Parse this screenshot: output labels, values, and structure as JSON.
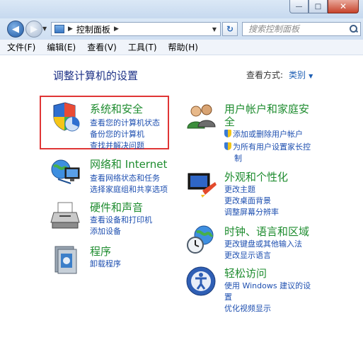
{
  "window": {
    "controls": {
      "minimize": "—",
      "maximize": "□",
      "close": "✕"
    }
  },
  "nav": {
    "back_icon": "arrow-left-icon",
    "forward_icon": "arrow-right-icon",
    "breadcrumb": [
      "控制面板"
    ],
    "refresh_symbol": "↻",
    "search_placeholder": "搜索控制面板"
  },
  "menu": [
    "文件(F)",
    "编辑(E)",
    "查看(V)",
    "工具(T)",
    "帮助(H)"
  ],
  "content": {
    "heading": "调整计算机的设置",
    "view_by_label": "查看方式:",
    "view_by_value": "类别",
    "categories": [
      {
        "title": "系统和安全",
        "icon": "shield-pie-icon",
        "links": [
          "查看您的计算机状态",
          "备份您的计算机",
          "查找并解决问题"
        ]
      },
      {
        "title": "网络和 Internet",
        "icon": "network-globe-icon",
        "links": [
          "查看网络状态和任务",
          "选择家庭组和共享选项"
        ]
      },
      {
        "title": "硬件和声音",
        "icon": "printer-icon",
        "links": [
          "查看设备和打印机",
          "添加设备"
        ]
      },
      {
        "title": "程序",
        "icon": "programs-icon",
        "links": [
          "卸载程序"
        ]
      },
      {
        "title_line1": "用户帐户和家庭安",
        "title_line2": "全",
        "icon": "users-icon",
        "links": [
          "添加或删除用户帐户",
          "为所有用户设置家长控",
          "制"
        ]
      },
      {
        "title": "外观和个性化",
        "icon": "display-paint-icon",
        "links": [
          "更改主题",
          "更改桌面背景",
          "调整屏幕分辨率"
        ]
      },
      {
        "title": "时钟、语言和区域",
        "icon": "clock-globe-icon",
        "links": [
          "更改键盘或其他输入法",
          "更改显示语言"
        ]
      },
      {
        "title": "轻松访问",
        "icon": "ease-of-access-icon",
        "links": [
          "使用 Windows 建议的设",
          "置",
          "优化视频显示"
        ]
      }
    ]
  },
  "colors": {
    "title_green": "#1e8c2f",
    "link_blue": "#1e4fb0",
    "heading_blue": "#1e3287",
    "highlight_red": "#e03535"
  }
}
